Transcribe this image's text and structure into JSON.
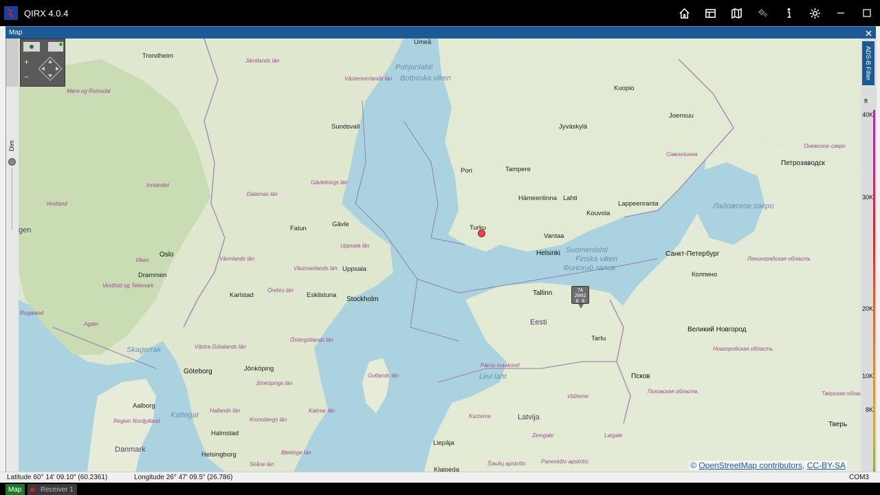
{
  "app": {
    "title": "QIRX 4.0.4"
  },
  "toolbar": {
    "icons": [
      "home-icon",
      "layout-icon",
      "map-icon",
      "satellite-icon",
      "info-icon",
      "gear-icon"
    ],
    "window_controls": [
      "minimize-icon",
      "maximize-icon"
    ]
  },
  "panel": {
    "title": "Map"
  },
  "map_controls": {
    "dim_label": "Dim",
    "plus": "+",
    "minus": "−"
  },
  "right_panel": {
    "adsb_filter_label": "ADS-B Filter",
    "unit_label": "ft",
    "altitude_ticks": [
      "40K",
      "30K",
      "20K",
      "10K",
      "8K"
    ]
  },
  "map_labels": {
    "cities": [
      "Trondheim",
      "Umeå",
      "Sundsvall",
      "Falun",
      "Gävle",
      "Oslo",
      "Drammen",
      "Uppsala",
      "Karlstad",
      "Eskilstuna",
      "Stockholm",
      "Göteborg",
      "Jönköping",
      "Halmstad",
      "Helsingborg",
      "Aalborg",
      "Pori",
      "Tampere",
      "Jyväskylä",
      "Kuopio",
      "Joensuu",
      "Hämeenlinna",
      "Lahti",
      "Kouvola",
      "Lappeenranta",
      "Turku",
      "Vantaa",
      "Helsinki",
      "Tallinn",
      "Tartu",
      "Liepāja",
      "Klaipėda"
    ],
    "big_cities": [
      "Санкт-Петербург",
      "Петрозаводск",
      "Великий Новгород",
      "Псков",
      "Тверь",
      "Колпино"
    ],
    "regions": [
      "Jämtlands län",
      "Västernorrlands län",
      "Gävleborgs län",
      "Dalarnas län",
      "Innlandet",
      "Viken",
      "Vestfold og Telemark",
      "Värmlands län",
      "Västmanlands län",
      "Uppsala län",
      "Örebro län",
      "Östergötlands län",
      "Västra Götalands län",
      "Jönköpings län",
      "Kalmar län",
      "Kronobergs län",
      "Hallands län",
      "Blekinge län",
      "Skåne län",
      "Gotlands län",
      "Møre og Romsdal",
      "Vestland",
      "Rogaland",
      "Agder",
      "Region Nordjylland",
      "Ленинградская область",
      "Новгородская область",
      "Псковская область",
      "Тверская область",
      "Pärnu maakond",
      "Kurzeme",
      "Zemgale",
      "Latgale",
      "Vidzeme",
      "Panevėžio apskritis",
      "Šiaulių apskritis",
      "Онежское озеро",
      "Савонлинна"
    ],
    "seas": [
      "Pohjanlahti",
      "Bottniska viken",
      "Skagerrak",
      "Kattegat",
      "Suomenlahti",
      "Finska viken",
      "Ладожское озеро",
      "Финский залив",
      "Liivi laht"
    ],
    "countries": [
      "Eesti",
      "Latvija",
      "Danmark",
      "gen"
    ]
  },
  "aircraft": {
    "line1": "7A",
    "line2": "2002",
    "line3": "0 0"
  },
  "attribution": {
    "prefix": "© ",
    "link1": "OpenStreetMap contributors",
    "sep": ", ",
    "link2": "CC-BY-SA"
  },
  "status": {
    "latitude": "Latitude  60° 14' 09.10\" (60.2361)",
    "longitude": "Longitude  26° 47' 09.5\" (26.786)",
    "port": "COM3"
  },
  "tabs": {
    "active": "Map",
    "inactive": "Receiver 1"
  }
}
